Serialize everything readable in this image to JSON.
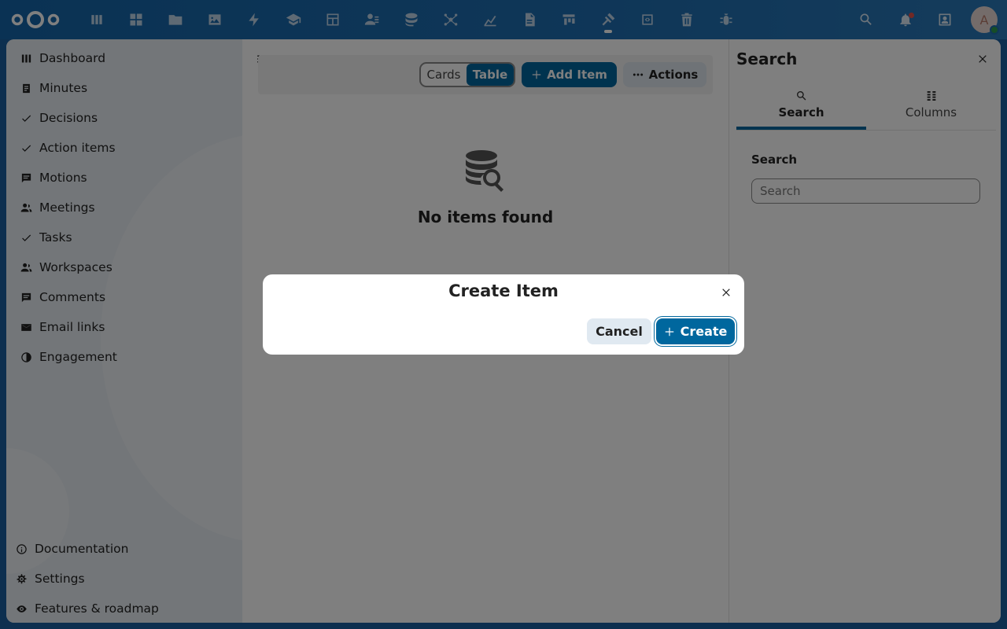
{
  "topbar": {
    "apps": [
      {
        "name": "dashboard-app-icon"
      },
      {
        "name": "grid-app-icon"
      },
      {
        "name": "files-app-icon"
      },
      {
        "name": "photos-app-icon"
      },
      {
        "name": "activity-app-icon"
      },
      {
        "name": "learning-app-icon"
      },
      {
        "name": "tables-app-icon"
      },
      {
        "name": "contacts-app-icon"
      },
      {
        "name": "database-app-icon"
      },
      {
        "name": "network-app-icon"
      },
      {
        "name": "analytics-app-icon"
      },
      {
        "name": "document-app-icon"
      },
      {
        "name": "deck-app-icon"
      },
      {
        "name": "gavel-app-icon"
      },
      {
        "name": "code-app-icon"
      },
      {
        "name": "trash-app-icon"
      },
      {
        "name": "bug-app-icon"
      }
    ],
    "avatar_letter": "A"
  },
  "sidebar": {
    "items": [
      {
        "label": "Dashboard",
        "icon": "dashboard-icon"
      },
      {
        "label": "Minutes",
        "icon": "minutes-icon"
      },
      {
        "label": "Decisions",
        "icon": "check-icon"
      },
      {
        "label": "Action items",
        "icon": "check-icon"
      },
      {
        "label": "Motions",
        "icon": "comment-icon"
      },
      {
        "label": "Meetings",
        "icon": "people-icon"
      },
      {
        "label": "Tasks",
        "icon": "check-icon"
      },
      {
        "label": "Workspaces",
        "icon": "people-icon"
      },
      {
        "label": "Comments",
        "icon": "comment-icon"
      },
      {
        "label": "Email links",
        "icon": "email-icon"
      },
      {
        "label": "Engagement",
        "icon": "half-circle-icon"
      }
    ],
    "bottom": [
      {
        "label": "Documentation",
        "icon": "info-icon"
      },
      {
        "label": "Settings",
        "icon": "gear-icon"
      },
      {
        "label": "Features & roadmap",
        "icon": "eye-icon"
      }
    ]
  },
  "main": {
    "view_cards": "Cards",
    "view_table": "Table",
    "add_item": "Add Item",
    "actions": "Actions",
    "empty_title": "No items found"
  },
  "right_panel": {
    "title": "Search",
    "tab_search": "Search",
    "tab_columns": "Columns",
    "field_label": "Search",
    "field_placeholder": "Search"
  },
  "modal": {
    "title": "Create Item",
    "cancel": "Cancel",
    "create": "Create"
  },
  "colors": {
    "primary": "#00679e",
    "header": "#1e6db0"
  }
}
